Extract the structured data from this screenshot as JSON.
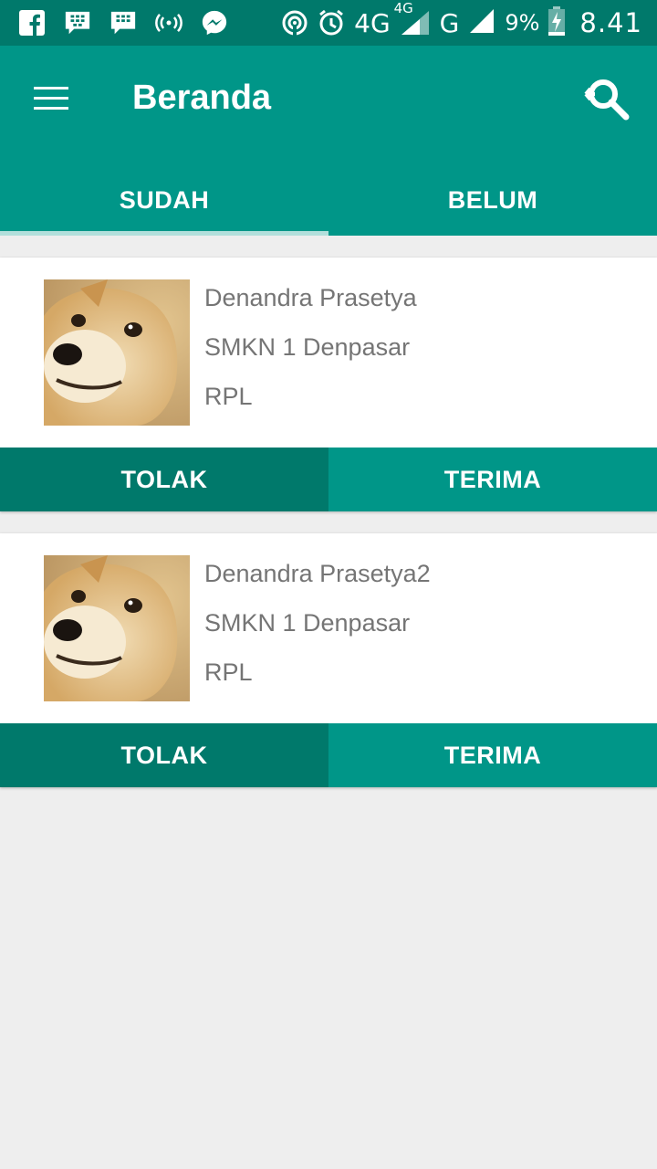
{
  "status_bar": {
    "icons_left": [
      "facebook-icon",
      "bbm-icon",
      "bbm-icon",
      "hotspot-icon",
      "messenger-icon"
    ],
    "net_4g": "4G",
    "net_4g_small": "4G",
    "net_g": "G",
    "battery": "9%",
    "time": "8.41"
  },
  "app_bar": {
    "title": "Beranda"
  },
  "tabs": [
    {
      "label": "SUDAH",
      "selected": true
    },
    {
      "label": "BELUM",
      "selected": false
    }
  ],
  "cards": [
    {
      "name": "Denandra Prasetya",
      "school": "SMKN 1 Denpasar",
      "major": "RPL",
      "reject_label": "TOLAK",
      "accept_label": "TERIMA"
    },
    {
      "name": "Denandra Prasetya2",
      "school": "SMKN 1 Denpasar",
      "major": "RPL",
      "reject_label": "TOLAK",
      "accept_label": "TERIMA"
    }
  ],
  "colors": {
    "primary": "#009688",
    "primary_dark": "#00796b",
    "indicator": "#b2dfdb",
    "background": "#eeeeee"
  }
}
